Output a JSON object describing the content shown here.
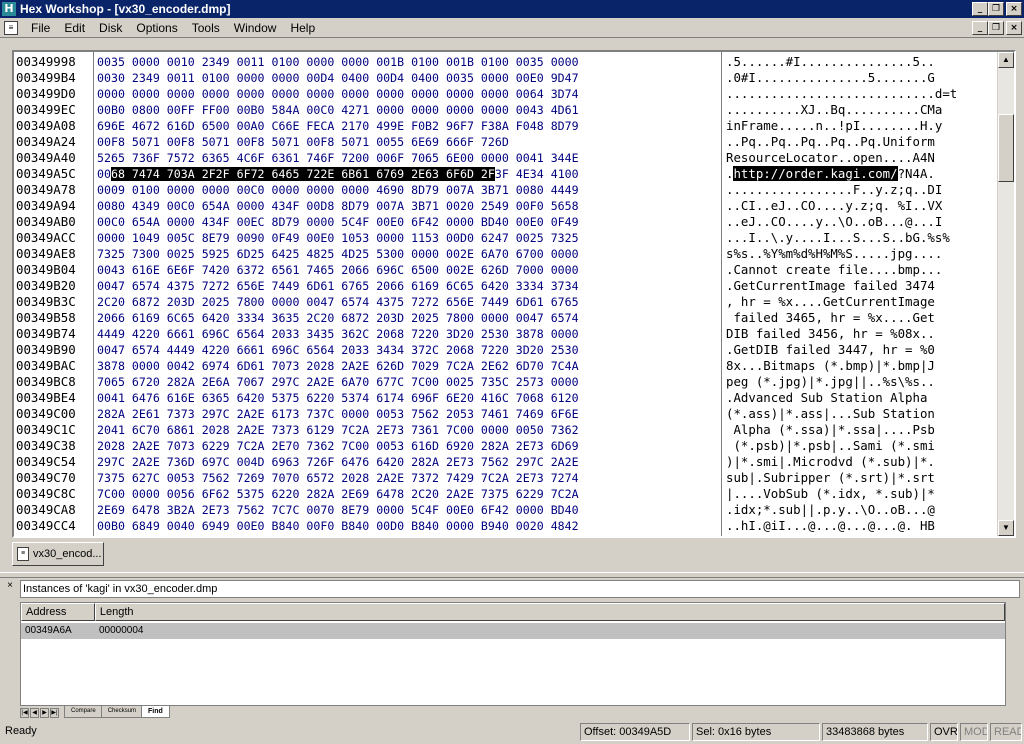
{
  "window": {
    "title": "Hex Workshop - [vx30_encoder.dmp]",
    "min_glyph": "_",
    "max_glyph": "❐",
    "close_glyph": "×"
  },
  "menu": [
    "File",
    "Edit",
    "Disk",
    "Options",
    "Tools",
    "Window",
    "Help"
  ],
  "editor": {
    "addresses": [
      "00349998",
      "003499B4",
      "003499D0",
      "003499EC",
      "00349A08",
      "00349A24",
      "00349A40",
      "00349A5C",
      "00349A78",
      "00349A94",
      "00349AB0",
      "00349ACC",
      "00349AE8",
      "00349B04",
      "00349B20",
      "00349B3C",
      "00349B58",
      "00349B74",
      "00349B90",
      "00349BAC",
      "00349BC8",
      "00349BE4",
      "00349C00",
      "00349C1C",
      "00349C38",
      "00349C54",
      "00349C70",
      "00349C8C",
      "00349CA8",
      "00349CC4"
    ],
    "hex": [
      "0035 0000 0010 2349 0011 0100 0000 0000 001B 0100 001B 0100 0035 0000",
      "0030 2349 0011 0100 0000 0000 00D4 0400 00D4 0400 0035 0000 00E0 9D47",
      "0000 0000 0000 0000 0000 0000 0000 0000 0000 0000 0000 0000 0064 3D74",
      "00B0 0800 00FF FF00 00B0 584A 00C0 4271 0000 0000 0000 0000 0043 4D61",
      "696E 4672 616D 6500 00A0 C66E FECA 2170 499E F0B2 96F7 F38A F048 8D79",
      "00F8 5071 00F8 5071 00F8 5071 00F8 5071 0055 6E69 666F 726D",
      "5265 736F 7572 6365 4C6F 6361 746F 7200 006F 7065 6E00 0000 0041 344E",
      "0068 7474 703A 2F2F 6F72 6465 722E 6B61 6769 2E63 6F6D 2F3F 4E34 4100",
      "0009 0100 0000 0000 00C0 0000 0000 0000 4690 8D79 007A 3B71 0080 4449",
      "0080 4349 00C0 654A 0000 434F 00D8 8D79 007A 3B71 0020 2549 00F0 5658",
      "00C0 654A 0000 434F 00EC 8D79 0000 5C4F 00E0 6F42 0000 BD40 00E0 0F49",
      "0000 1049 005C 8E79 0090 0F49 00E0 1053 0000 1153 00D0 6247 0025 7325",
      "7325 7300 0025 5925 6D25 6425 4825 4D25 5300 0000 002E 6A70 6700 0000",
      "0043 616E 6E6F 7420 6372 6561 7465 2066 696C 6500 002E 626D 7000 0000",
      "0047 6574 4375 7272 656E 7449 6D61 6765 2066 6169 6C65 6420 3334 3734",
      "2C20 6872 203D 2025 7800 0000 0047 6574 4375 7272 656E 7449 6D61 6765",
      "2066 6169 6C65 6420 3334 3635 2C20 6872 203D 2025 7800 0000 0047 6574",
      "4449 4220 6661 696C 6564 2033 3435 362C 2068 7220 3D20 2530 3878 0000",
      "0047 6574 4449 4220 6661 696C 6564 2033 3434 372C 2068 7220 3D20 2530",
      "3878 0000 0042 6974 6D61 7073 2028 2A2E 626D 7029 7C2A 2E62 6D70 7C4A",
      "7065 6720 282A 2E6A 7067 297C 2A2E 6A70 677C 7C00 0025 735C 2573 0000",
      "0041 6476 616E 6365 6420 5375 6220 5374 6174 696F 6E20 416C 7068 6120",
      "282A 2E61 7373 297C 2A2E 6173 737C 0000 0053 7562 2053 7461 7469 6F6E",
      "2041 6C70 6861 2028 2A2E 7373 6129 7C2A 2E73 7361 7C00 0000 0050 7362",
      "2028 2A2E 7073 6229 7C2A 2E70 7362 7C00 0053 616D 6920 282A 2E73 6D69",
      "297C 2A2E 736D 697C 004D 6963 726F 6476 6420 282A 2E73 7562 297C 2A2E",
      "7375 627C 0053 7562 7269 7070 6572 2028 2A2E 7372 7429 7C2A 2E73 7274",
      "7C00 0000 0056 6F62 5375 6220 282A 2E69 6478 2C20 2A2E 7375 6229 7C2A",
      "2E69 6478 3B2A 2E73 7562 7C7C 0070 8E79 0000 5C4F 00E0 6F42 0000 BD40",
      "00B0 6849 0040 6949 00E0 B840 00F0 B840 00D0 B840 0000 B940 0020 4842"
    ],
    "hex_row7_pre": "00",
    "hex_row7_sel": "68 7474 703A 2F2F 6F72 6465 722E 6B61 6769 2E63 6F6D 2F",
    "hex_row7_post": "3F 4E34 4100",
    "ascii": [
      ".5......#I...............5..",
      ".0#I...............5.......G",
      "............................d=t",
      "..........XJ..Bq..........CMa",
      "inFrame.....n..!pI........H.y",
      "..Pq..Pq..Pq..Pq..Pq.Uniform",
      "ResourceLocator..open....A4N",
      ".http://order.kagi.com/?N4A.",
      ".................F..y.z;q..DI",
      "..CI..eJ..CO....y.z;q. %I..VX",
      "..eJ..CO....y..\\O..oB...@...I",
      "...I..\\.y....I...S...S..bG.%s%",
      "s%s..%Y%m%d%H%M%S.....jpg....",
      ".Cannot create file....bmp...",
      ".GetCurrentImage failed 3474",
      ", hr = %x....GetCurrentImage",
      " failed 3465, hr = %x....Get",
      "DIB failed 3456, hr = %08x..",
      ".GetDIB failed 3447, hr = %0",
      "8x...Bitmaps (*.bmp)|*.bmp|J",
      "peg (*.jpg)|*.jpg||..%s\\%s..",
      ".Advanced Sub Station Alpha ",
      "(*.ass)|*.ass|...Sub Station",
      " Alpha (*.ssa)|*.ssa|....Psb",
      " (*.psb)|*.psb|..Sami (*.smi",
      ")|*.smi|.Microdvd (*.sub)|*.",
      "sub|.Subripper (*.srt)|*.srt",
      "|....VobSub (*.idx, *.sub)|*",
      ".idx;*.sub||.p.y..\\O..oB...@",
      "..hI.@iI...@...@...@...@. HB"
    ],
    "ascii_row7_pre": ".",
    "ascii_row7_sel": "http://order.kagi.com/",
    "ascii_row7_post": "?N4A.",
    "scroll_up_glyph": "▲",
    "scroll_down_glyph": "▼",
    "scroll_position_fraction": 0.12
  },
  "doc_tab": {
    "label": "vx30_encod..."
  },
  "results": {
    "close_glyph": "×",
    "title": "Instances of 'kagi' in vx30_encoder.dmp",
    "columns": [
      "Address",
      "Length"
    ],
    "rows": [
      {
        "address": "00349A6A",
        "length": "00000004"
      }
    ],
    "tabs": [
      "Compare",
      "Checksum",
      "Find"
    ],
    "active_tab": "Find"
  },
  "status": {
    "ready": "Ready",
    "offset": "Offset: 00349A5D",
    "selection": "Sel: 0x16 bytes",
    "size": "33483868 bytes",
    "ovr": "OVR",
    "mod": "MOD",
    "read": "READ"
  }
}
